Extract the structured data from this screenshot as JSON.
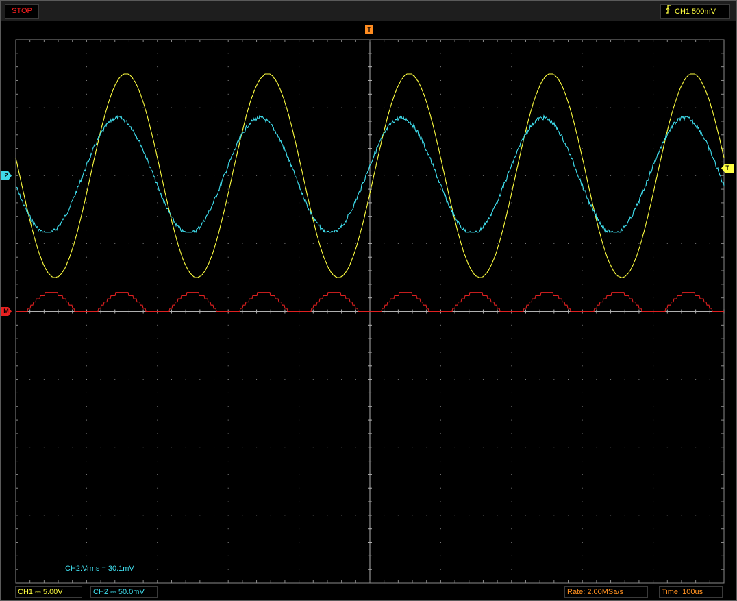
{
  "status": {
    "run_state": "STOP"
  },
  "trigger": {
    "icon": "rising-edge-icon",
    "source_level": "CH1 500mV",
    "position_marker": "T",
    "level_marker": "T"
  },
  "markers": {
    "ch2": "2",
    "math": "M"
  },
  "measurement": {
    "text": "CH2:Vrms = 30.1mV"
  },
  "bottom": {
    "ch1_scale": "CH1 ⎓ 5.00V",
    "ch2_scale": "CH2 ⎓ 50.0mV",
    "rate": "Rate: 2.00MSa/s",
    "time": "Time:  100us"
  },
  "colors": {
    "ch1": "#ffff40",
    "ch2": "#40e0f0",
    "math": "#e02020",
    "trigger": "#ff8c20",
    "grid": "#8a8a8a"
  },
  "chart_data": {
    "type": "line",
    "grid": {
      "h_divs": 10,
      "v_divs": 8
    },
    "x": {
      "unit": "us",
      "per_div": 100,
      "range": [
        -500,
        500
      ]
    },
    "series": [
      {
        "name": "CH1",
        "color": "#ffff40",
        "volts_per_div": 5.0,
        "offset_div": 2.0,
        "shape": "sine",
        "period_div": 2.0,
        "amplitude_div": 1.5,
        "phase_deg": 170
      },
      {
        "name": "CH2",
        "color": "#40e0f0",
        "volts_per_div": 0.05,
        "offset_div": 2.0,
        "shape": "sine_noisy",
        "period_div": 2.0,
        "amplitude_div": 0.85,
        "phase_deg": 190
      },
      {
        "name": "M",
        "color": "#e02020",
        "offset_div": 0.0,
        "shape": "stepped_pulse",
        "period_div": 1.0,
        "amplitude_div": 0.28
      }
    ]
  }
}
